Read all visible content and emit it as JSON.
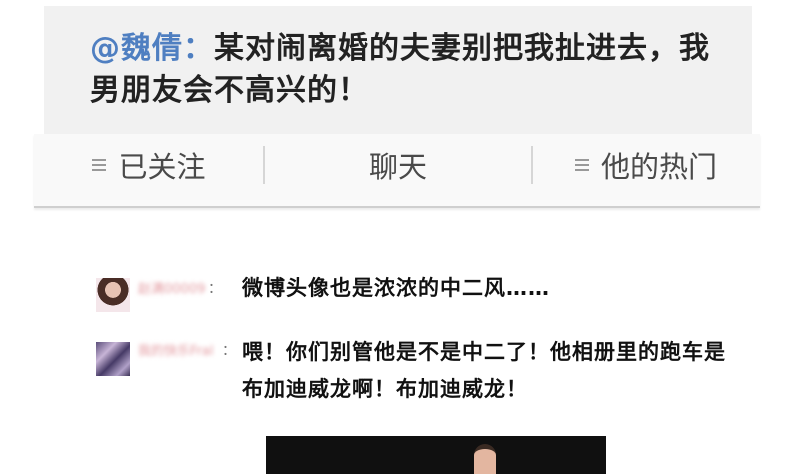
{
  "post": {
    "author": "@魏倩：",
    "text": "某对闹离婚的夫妻别把我扯进去，我男朋友会不高兴的！"
  },
  "tabs": {
    "follow": "已关注",
    "chat": "聊天",
    "hot": "他的热门"
  },
  "icons": {
    "menu": "menu-lines-icon"
  },
  "comments": [
    {
      "user": "赵满00009",
      "colon": "：",
      "text": "微博头像也是浓浓的中二风……"
    },
    {
      "user": "我的快乐Fral",
      "colon": "：",
      "text": "喂！你们别管他是不是中二了！他相册里的跑车是布加迪威龙啊！布加迪威龙！"
    }
  ],
  "colors": {
    "author": "#4f7fc1",
    "card_bg": "#f1f1f1",
    "tab_text": "#4a4a4a"
  }
}
